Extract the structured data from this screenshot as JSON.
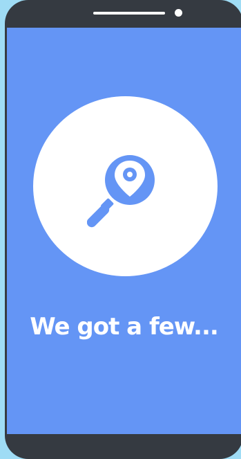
{
  "colors": {
    "background": "#9fdcf5",
    "phone_body": "#353a41",
    "screen": "#6495f5",
    "accent": "#ffffff"
  },
  "icons": {
    "main": "magnifier-location-pin-icon"
  },
  "screen": {
    "headline": "We got a few..."
  }
}
